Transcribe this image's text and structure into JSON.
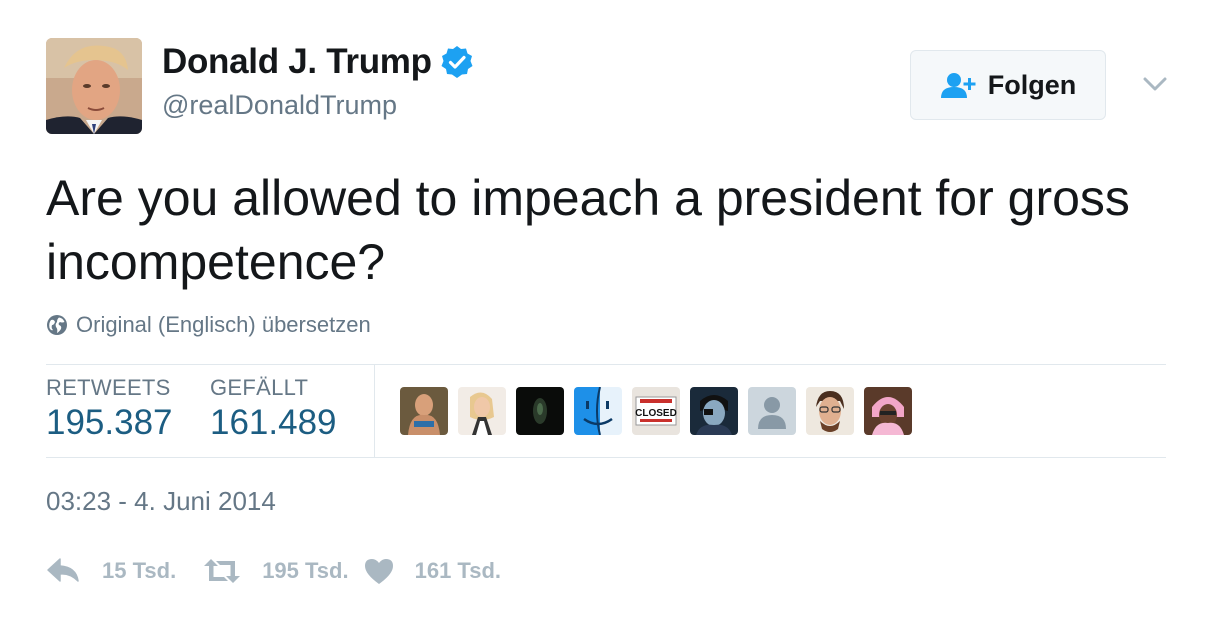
{
  "author": {
    "name": "Donald J. Trump",
    "handle": "@realDonaldTrump",
    "verified": true,
    "avatar_icon": "portrait-photo"
  },
  "follow_button": {
    "label": "Folgen",
    "icon": "follow-person-plus-icon"
  },
  "tweet": {
    "text": "Are you allowed to impeach a president for gross incompetence?",
    "translate_label": "Original (Englisch) übersetzen"
  },
  "stats": {
    "retweets_label": "RETWEETS",
    "retweets_value": "195.387",
    "likes_label": "GEFÄLLT",
    "likes_value": "161.489"
  },
  "likers": [
    {
      "name": "liker-1"
    },
    {
      "name": "liker-2"
    },
    {
      "name": "liker-3"
    },
    {
      "name": "liker-4"
    },
    {
      "name": "liker-5"
    },
    {
      "name": "liker-6"
    },
    {
      "name": "liker-7"
    },
    {
      "name": "liker-8"
    },
    {
      "name": "liker-9"
    }
  ],
  "likers_closed_sign_text": "CLOSED",
  "timestamp": "03:23 - 4. Juni 2014",
  "actions": {
    "reply_count": "15 Tsd.",
    "retweet_count": "195 Tsd.",
    "like_count": "161 Tsd."
  },
  "colors": {
    "accent_blue": "#1da1f2",
    "stat_value": "#1c5d82",
    "muted": "#657786",
    "action_gray": "#aab8c2",
    "border": "#e1e8ed"
  }
}
